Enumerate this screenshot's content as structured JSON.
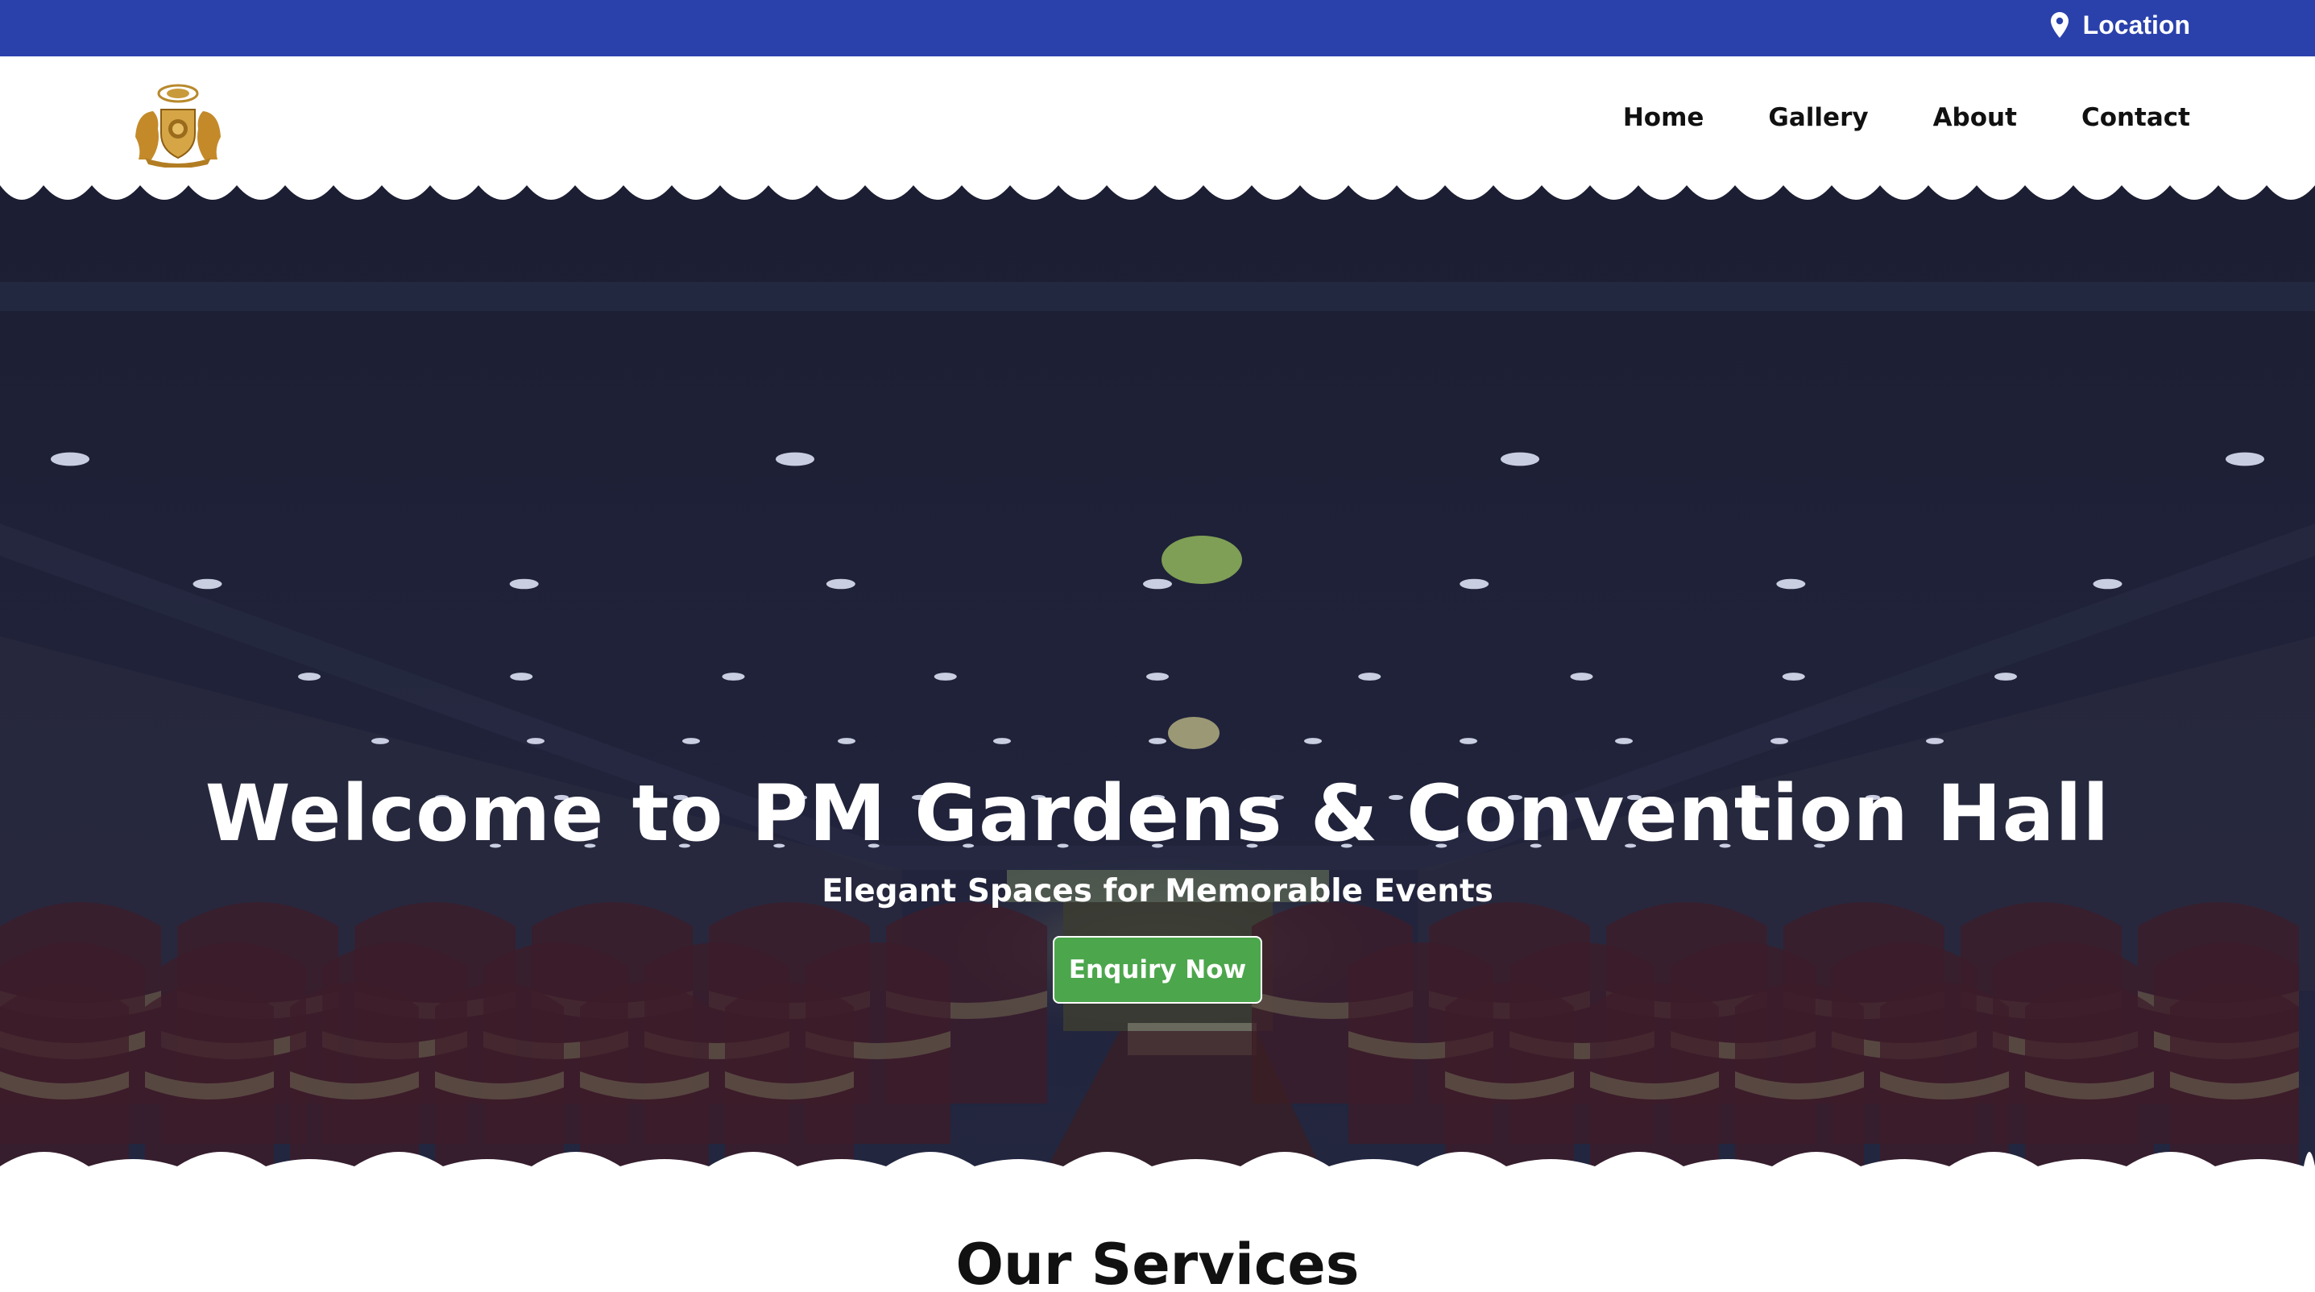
{
  "topbar": {
    "location_label": "Location",
    "icon": "map-pin-icon",
    "background_color": "#2a41ac"
  },
  "header": {
    "logo_name": "pm-crest-logo",
    "nav": [
      {
        "label": "Home"
      },
      {
        "label": "Gallery"
      },
      {
        "label": "About"
      },
      {
        "label": "Contact"
      }
    ]
  },
  "hero": {
    "title": "Welcome to PM Gardens & Convention Hall",
    "subtitle": "Elegant Spaces for Memorable Events",
    "cta_label": "Enquiry Now",
    "cta_color": "#4ca64c"
  },
  "services": {
    "title": "Our Services"
  }
}
